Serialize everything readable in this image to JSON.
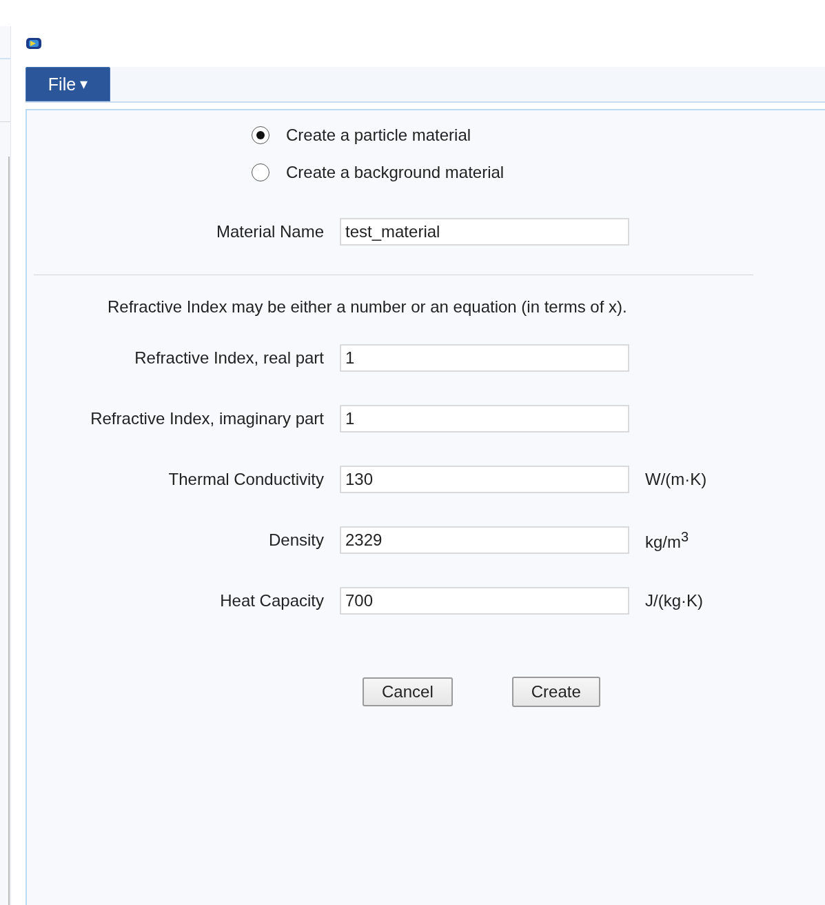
{
  "menu": {
    "label": "File",
    "caret": "▾"
  },
  "material_type": [
    {
      "label": "Create a particle material",
      "selected": true
    },
    {
      "label": "Create a background material",
      "selected": false
    }
  ],
  "material_name": {
    "label": "Material Name",
    "value": "test_material"
  },
  "note": "Refractive Index may be either a number or an equation (in terms of x).",
  "properties": [
    {
      "label": "Refractive Index, real part",
      "value": "1"
    },
    {
      "label": "Refractive Index, imaginary part",
      "value": "1"
    },
    {
      "label": "Thermal Conductivity",
      "value": "130",
      "unit": "W/(m·K)"
    },
    {
      "label": "Density",
      "value": "2329",
      "unit": "kg/m$^{3}$"
    },
    {
      "label": "Heat Capacity",
      "value": "700",
      "unit": "J/(kg·K)"
    }
  ],
  "buttons": [
    "Cancel",
    "Create"
  ]
}
